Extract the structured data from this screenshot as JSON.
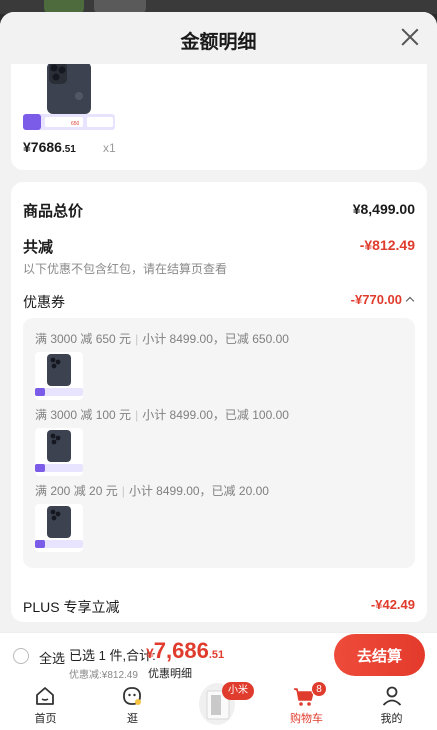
{
  "sheet": {
    "title": "金额明细"
  },
  "product": {
    "price_main": "¥7686",
    "price_cents": ".51",
    "qty": "x1",
    "thumb_promo": "650"
  },
  "detail": {
    "total_label": "商品总价",
    "total_value": "¥8,499.00",
    "reduce_label": "共减",
    "reduce_value": "-¥812.49",
    "note": "以下优惠不包含红包，请在结算页查看",
    "coupon_label": "优惠券",
    "coupon_value": "-¥770.00",
    "coupons": [
      {
        "rule": "满 3000 减 650 元",
        "summary": "小计 8499.00，已减 650.00"
      },
      {
        "rule": "满 3000 减 100 元",
        "summary": "小计 8499.00，已减 100.00"
      },
      {
        "rule": "满 200 减 20 元",
        "summary": "小计 8499.00，已减 20.00"
      }
    ],
    "plus_label": "PLUS 专享立减",
    "plus_value": "-¥42.49"
  },
  "checkout": {
    "select_all": "全选",
    "selected_text": "已选 1 件,合计:",
    "total_currency": "¥",
    "total_main": "7,686",
    "total_cents": ".51",
    "discount_text": "优惠减:¥812.49",
    "detail_link": "优惠明细",
    "button": "去结算"
  },
  "tabs": [
    {
      "label": "首页",
      "icon": "home-icon"
    },
    {
      "label": "逛",
      "icon": "explore-icon"
    },
    {
      "label": "",
      "icon": "xiaomi-product",
      "tag": "小米"
    },
    {
      "label": "购物车",
      "icon": "cart-icon",
      "badge": "8",
      "active": true
    },
    {
      "label": "我的",
      "icon": "profile-icon"
    }
  ],
  "colors": {
    "accent": "#e03c2d",
    "sheet_bg": "#f2f2f2",
    "card_bg": "#ffffff"
  }
}
